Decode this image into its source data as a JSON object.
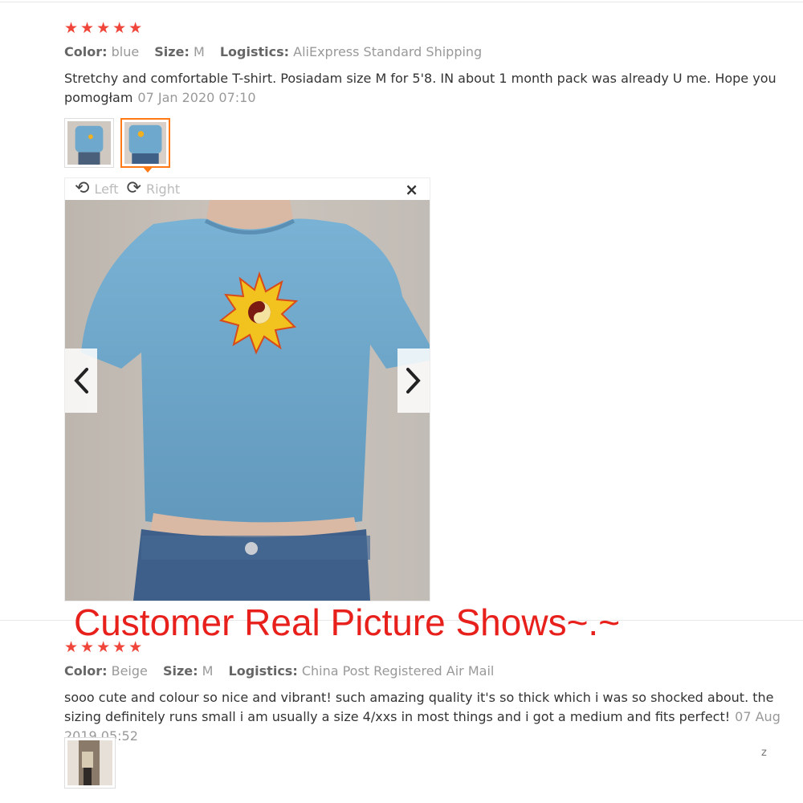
{
  "reviews": [
    {
      "stars": "★★★★★",
      "meta": {
        "color_key": "Color:",
        "color_val": "blue",
        "size_key": "Size:",
        "size_val": "M",
        "logistics_key": "Logistics:",
        "logistics_val": "AliExpress Standard Shipping"
      },
      "text": "Stretchy and comfortable T-shirt. Posiadam size M for 5'8. IN about 1 month pack was already U me. Hope you pomogłam",
      "date": "07 Jan 2020 07:10"
    },
    {
      "stars": "★★★★★",
      "meta": {
        "color_key": "Color:",
        "color_val": "Beige",
        "size_key": "Size:",
        "size_val": "M",
        "logistics_key": "Logistics:",
        "logistics_val": "China Post Registered Air Mail"
      },
      "text": "sooo cute and colour so nice and vibrant! such amazing quality it's so thick which i was so shocked about. the sizing definitely runs small i am usually a size 4/xxs in most things and i got a medium and fits perfect!",
      "date": "07 Aug 2019 05:52"
    }
  ],
  "viewer": {
    "rotate_left": "Left",
    "rotate_right": "Right",
    "close": "×"
  },
  "banner": "Customer Real Picture Shows~.~",
  "colors": {
    "star": "#f0453a",
    "active_border": "#ff7a17",
    "banner": "#e8201c",
    "shirt": "#6ea8cc"
  }
}
